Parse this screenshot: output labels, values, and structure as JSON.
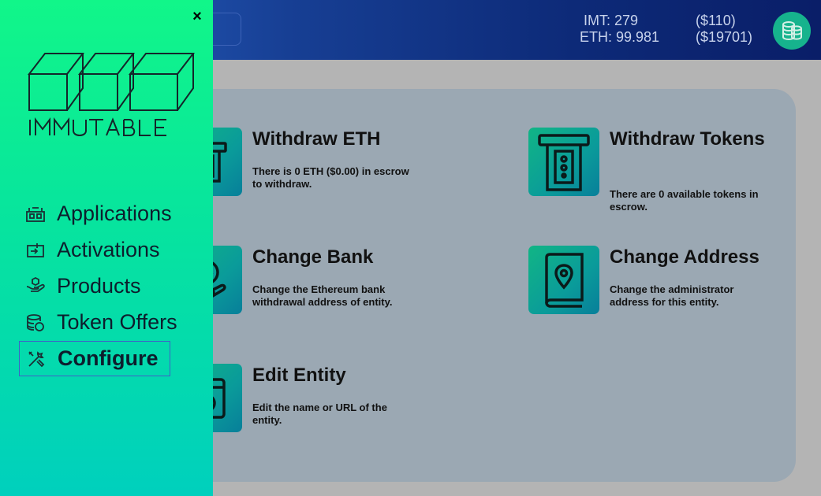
{
  "header": {
    "imt_label": "IMT: 279",
    "imt_usd": "($110)",
    "eth_label": "ETH: 99.981",
    "eth_usd": "($19701)",
    "wallet_icon": "coin-stack-icon"
  },
  "drawer": {
    "close_label": "×",
    "logo_text": "IMMUTABLE",
    "items": [
      {
        "label": "Applications",
        "icon": "applications-icon"
      },
      {
        "label": "Activations",
        "icon": "activations-icon"
      },
      {
        "label": "Products",
        "icon": "products-icon"
      },
      {
        "label": "Token Offers",
        "icon": "token-offers-icon"
      },
      {
        "label": "Configure",
        "icon": "configure-icon",
        "active": true
      }
    ]
  },
  "cards": [
    {
      "title": "Withdraw ETH",
      "desc": "There is 0 ETH ($0.00) in escrow to withdraw.",
      "icon": "atm-icon"
    },
    {
      "title": "Withdraw Tokens",
      "desc": "There are 0 available tokens in escrow.",
      "icon": "atm-withdraw-icon"
    },
    {
      "title": "Change Bank",
      "desc": "Change the Ethereum bank withdrawal address of entity.",
      "icon": "ethereum-hand-icon"
    },
    {
      "title": "Change Address",
      "desc": "Change the administrator address for this entity.",
      "icon": "address-book-icon"
    },
    {
      "title": "Edit Entity",
      "desc": "Edit the name or URL of the entity.",
      "icon": "safe-icon"
    }
  ]
}
